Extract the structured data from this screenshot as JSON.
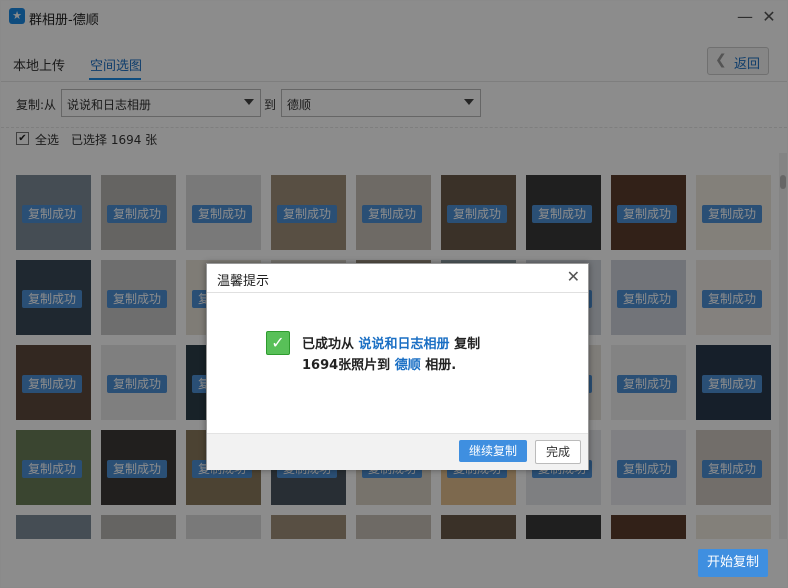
{
  "window": {
    "title": "群相册-德顺",
    "minimize_glyph": "—",
    "close_glyph": "✕",
    "icon": "star-app-icon"
  },
  "tabs": [
    {
      "label": "本地上传"
    },
    {
      "label": "空间选图"
    }
  ],
  "back_button": {
    "label": "返回"
  },
  "copy": {
    "from_label": "复制:从",
    "from_value": "说说和日志相册",
    "to_label": "到",
    "to_value": "德顺"
  },
  "selection": {
    "select_all": "全选",
    "selected_count": "已选择 1694 张"
  },
  "thumb_badge": "复制成功",
  "thumb_colors": [
    "#6a7f58",
    "#3c3a38",
    "#8a7a5e",
    "#4a5560",
    "#d9d2c5",
    "#e4c08e",
    "#e6e8ec",
    "#e9eaee",
    "#cfc9c2",
    "#7f8c9a",
    "#b9b7b3",
    "#dcdcdc",
    "#a0907a",
    "#c8c2b8",
    "#6a5a4a",
    "#3a3a3a",
    "#5b3d2d",
    "#efe9df",
    "#394a58",
    "#c9c9c9",
    "#e7e2d8",
    "#d8d1c6",
    "#9c9080",
    "#8e9ea7",
    "#d0d6dc",
    "#cfd4dc",
    "#f0ece6",
    "#5d4a3d",
    "#e8e8e8",
    "#2d3e4a",
    "#f2f2f2",
    "#cdb89c",
    "#e0d6c8",
    "#e8e4dc",
    "#efefef",
    "#283a4d"
  ],
  "start_button": {
    "label": "开始复制"
  },
  "dialog": {
    "title": "温馨提示",
    "close_glyph": "✕",
    "msg_prefix": "已成功从",
    "msg_source": "说说和日志相册",
    "msg_copy": "复制",
    "msg_count": "1694张照片到",
    "msg_target": "德顺",
    "msg_suffix": "相册.",
    "continue_label": "继续复制",
    "done_label": "完成"
  }
}
